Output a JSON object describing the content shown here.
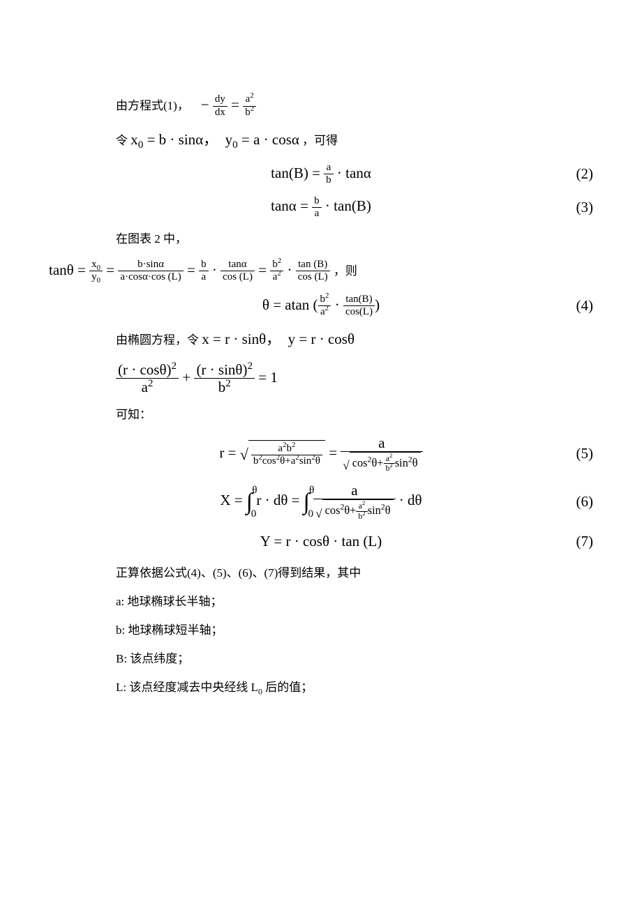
{
  "para1_prefix": "由方程式(1)，",
  "eq1_inline": "− dy/dx = a²/b²",
  "para2_prefix": "令",
  "para2_math": "x₀ = b · sinα，  y₀ = a · cosα",
  "para2_suffix": "，可得",
  "eq2_latex": "tan(B) = (a/b) · tanα",
  "eq2_no": "(2)",
  "eq3_latex": "tanα = (b/a) · tan(B)",
  "eq3_no": "(3)",
  "para3": "在图表 2 中，",
  "eq_tan_theta": "tanθ = x₀/y₀ = (b·sinα)/(a·cosα·cos(L)) = (b/a)·(tanα/cos(L)) = (b²/a²)·(tan(B)/cos(L))",
  "para3_suffix": "，则",
  "eq4_latex": "θ = atan( (b²/a²) · tan(B)/cos(L) )",
  "eq4_no": "(4)",
  "para4_prefix": "由椭圆方程，令",
  "para4_math": "x = r · sinθ，  y = r · cosθ",
  "eq_ellipse": "(r·cosθ)²/a² + (r·sinθ)²/b² = 1",
  "para5": "可知：",
  "eq5_latex": "r = √( a²b² / (b²cos²θ + a²sin²θ) ) = a / √( cos²θ + (a²/b²) sin²θ )",
  "eq5_no": "(5)",
  "eq6_latex": "X = ∫₀^θ r·dθ = ∫₀^θ a / √( cos²θ + (a²/b²) sin²θ ) · dθ",
  "eq6_no": "(6)",
  "eq7_latex": "Y = r · cosθ · tan(L)",
  "eq7_no": "(7)",
  "para6": "正算依据公式(4)、(5)、(6)、(7)得到结果，其中",
  "def_a": "a: 地球椭球长半轴；",
  "def_b": "b: 地球椭球短半轴；",
  "def_B": "B: 该点纬度；",
  "def_L": "L: 该点经度减去中央经线 L₀后的值；"
}
